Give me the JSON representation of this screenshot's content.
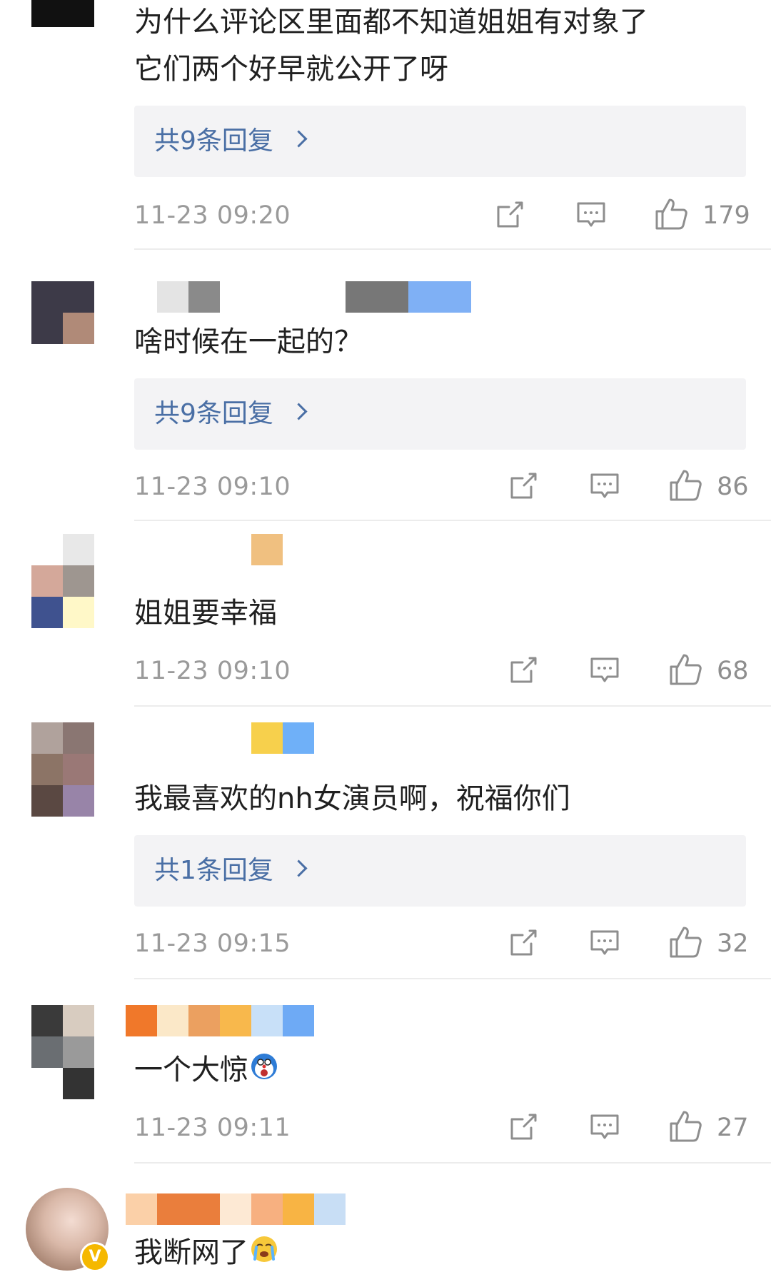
{
  "comments": [
    {
      "text_lines": [
        "为什么评论区里面都不知道姐姐有对象了",
        "它们两个好早就公开了呀"
      ],
      "replies_label": "共9条回复",
      "time": "11-23 09:20",
      "likes": "179"
    },
    {
      "text_lines": [
        "啥时候在一起的？"
      ],
      "replies_label": "共9条回复",
      "time": "11-23 09:10",
      "likes": "86"
    },
    {
      "text_lines": [
        "姐姐要幸福"
      ],
      "time": "11-23 09:10",
      "likes": "68"
    },
    {
      "text_lines": [
        "我最喜欢的nh女演员啊，祝福你们"
      ],
      "replies_label": "共1条回复",
      "time": "11-23 09:15",
      "likes": "32"
    },
    {
      "text_lines": [
        "一个大惊"
      ],
      "emoji": "surprised-face-emoji",
      "time": "11-23 09:11",
      "likes": "27"
    },
    {
      "text_lines": [
        "我断网了"
      ],
      "emoji": "crying-face-emoji",
      "verified_badge": "V"
    }
  ],
  "icons": {
    "share": "share-icon",
    "comment": "comment-icon",
    "like": "thumbs-up-icon",
    "chevron": "chevron-right-icon"
  },
  "colors": {
    "reply_link": "#4a6fa5",
    "meta_text": "#9a9a9a",
    "reply_bg": "#f3f3f5",
    "verified": "#f5b800"
  }
}
